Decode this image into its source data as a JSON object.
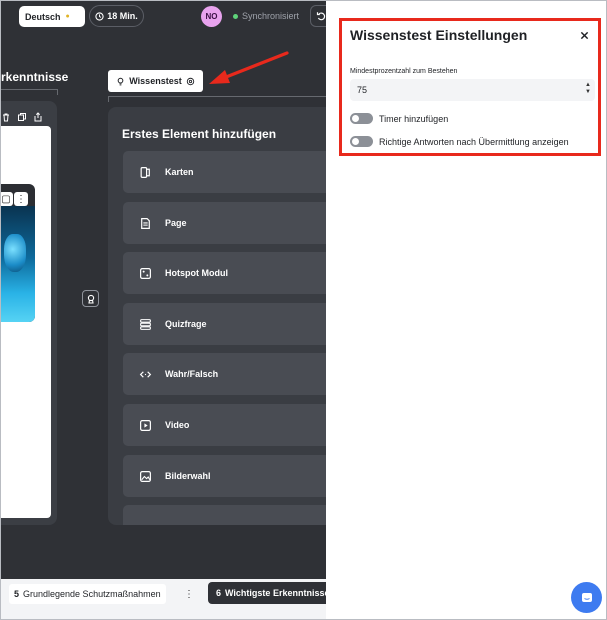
{
  "topbar": {
    "language": "Deutsch",
    "duration": "18 Min.",
    "avatar_initials": "NO",
    "sync_status": "Synchronisiert"
  },
  "left_column": {
    "title": "rkenntnisse"
  },
  "quiz_tab": {
    "label": "Wissenstest"
  },
  "add_panel": {
    "title": "Erstes Element hinzufügen",
    "items": [
      {
        "label": "Karten",
        "icon": "cards-icon"
      },
      {
        "label": "Page",
        "icon": "page-icon"
      },
      {
        "label": "Hotspot Modul",
        "icon": "hotspot-icon"
      },
      {
        "label": "Quizfrage",
        "icon": "quiz-question-icon"
      },
      {
        "label": "Wahr/Falsch",
        "icon": "code-arrows-icon"
      },
      {
        "label": "Video",
        "icon": "video-icon"
      },
      {
        "label": "Bilderwahl",
        "icon": "image-icon"
      }
    ]
  },
  "bottom_tabs": {
    "tab1_num": "5",
    "tab1_label": "Grundlegende Schutzmaßnahmen",
    "tab2_num": "6",
    "tab2_label": "Wichtigste Erkenntnisse"
  },
  "settings": {
    "title": "Wissenstest Einstellungen",
    "min_label": "Mindestprozentzahl zum Bestehen",
    "min_value": "75",
    "timer_label": "Timer hinzufügen",
    "answers_label": "Richtige Antworten nach Übermittlung anzeigen"
  },
  "colors": {
    "highlight": "#e8291c",
    "editor_bg": "#2f3136",
    "accent_blue": "#3e7bf0"
  }
}
